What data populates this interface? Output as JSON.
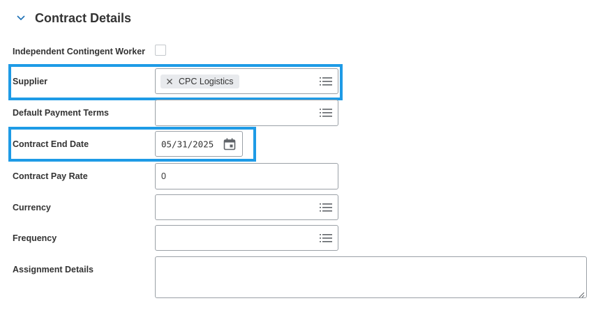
{
  "section": {
    "title": "Contract Details",
    "toggle_icon": "chevron-down-icon"
  },
  "fields": {
    "independent_contingent_worker": {
      "label": "Independent Contingent Worker",
      "checked": false
    },
    "supplier": {
      "label": "Supplier",
      "selected_value": "CPC Logistics",
      "icon": "list-icon"
    },
    "default_payment_terms": {
      "label": "Default Payment Terms",
      "value": "",
      "icon": "list-icon"
    },
    "contract_end_date": {
      "label": "Contract End Date",
      "value": "05/31/2025",
      "icon": "calendar-icon"
    },
    "contract_pay_rate": {
      "label": "Contract Pay Rate",
      "value": "0"
    },
    "currency": {
      "label": "Currency",
      "value": "",
      "icon": "list-icon"
    },
    "frequency": {
      "label": "Frequency",
      "value": "",
      "icon": "list-icon"
    },
    "assignment_details": {
      "label": "Assignment Details",
      "value": ""
    }
  },
  "colors": {
    "highlight": "#1e9be6",
    "chevron": "#1a6fb5",
    "text": "#333333",
    "border": "#9aa0a6"
  }
}
